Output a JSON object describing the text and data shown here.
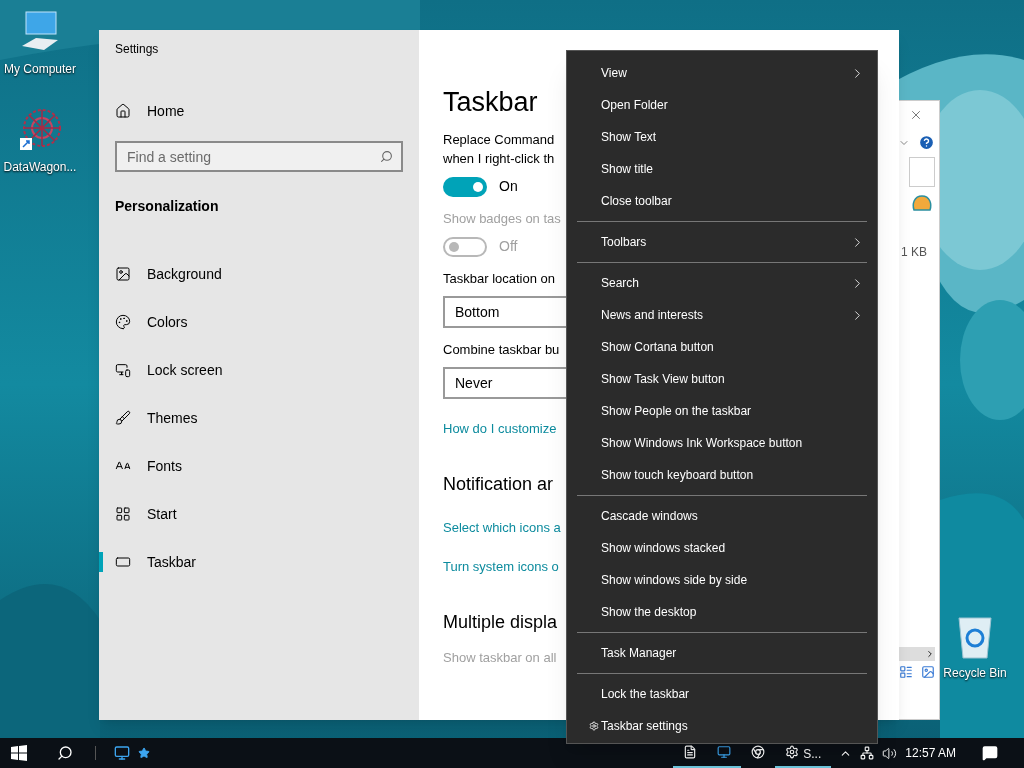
{
  "desktop_icons": [
    {
      "kind": "computer",
      "label": "My Computer"
    },
    {
      "kind": "shortcut",
      "label": "DataWagon..."
    },
    {
      "kind": "recycle",
      "label": "Recycle Bin"
    }
  ],
  "settings": {
    "title": "Settings",
    "sidebar": {
      "home": "Home",
      "search": {
        "placeholder": "Find a setting"
      },
      "section": "Personalization",
      "items": [
        {
          "kind": "background",
          "label": "Background",
          "selected": false
        },
        {
          "kind": "colors",
          "label": "Colors",
          "selected": false
        },
        {
          "kind": "lock",
          "label": "Lock screen",
          "selected": false
        },
        {
          "kind": "themes",
          "label": "Themes",
          "selected": false
        },
        {
          "kind": "fonts",
          "label": "Fonts",
          "selected": false
        },
        {
          "kind": "start",
          "label": "Start",
          "selected": false
        },
        {
          "kind": "taskbar",
          "label": "Taskbar",
          "selected": true
        }
      ]
    },
    "page": {
      "heading": "Taskbar",
      "blocks": [
        {
          "kind": "label",
          "lines": [
            "Replace Command",
            "when I right-click th"
          ],
          "disabled": false
        },
        {
          "kind": "toggle",
          "on": true,
          "disabled": false,
          "text": "On"
        },
        {
          "kind": "label",
          "lines": [
            "Show badges on tas"
          ],
          "disabled": true
        },
        {
          "kind": "toggle",
          "on": false,
          "disabled": true,
          "text": "Off"
        },
        {
          "kind": "label",
          "lines": [
            "Taskbar location on"
          ],
          "disabled": false
        },
        {
          "kind": "select",
          "value": "Bottom"
        },
        {
          "kind": "label",
          "lines": [
            "Combine taskbar bu"
          ],
          "disabled": false
        },
        {
          "kind": "select",
          "value": "Never"
        },
        {
          "kind": "link",
          "text": "How do I customize"
        },
        {
          "kind": "heading",
          "text": "Notification ar"
        },
        {
          "kind": "link",
          "text": "Select which icons a"
        },
        {
          "kind": "link",
          "text": "Turn system icons o"
        },
        {
          "kind": "heading",
          "text": "Multiple displa"
        },
        {
          "kind": "label",
          "lines": [
            "Show taskbar on all"
          ],
          "disabled": true
        }
      ]
    }
  },
  "context_menu": {
    "sections": [
      [
        {
          "label": "View",
          "submenu": true
        },
        {
          "label": "Open Folder",
          "submenu": false
        },
        {
          "label": "Show Text",
          "submenu": false
        },
        {
          "label": "Show title",
          "submenu": false
        },
        {
          "label": "Close toolbar",
          "submenu": false
        }
      ],
      [
        {
          "label": "Toolbars",
          "submenu": true
        }
      ],
      [
        {
          "label": "Search",
          "submenu": true
        },
        {
          "label": "News and interests",
          "submenu": true
        },
        {
          "label": "Show Cortana button",
          "submenu": false
        },
        {
          "label": "Show Task View button",
          "submenu": false
        },
        {
          "label": "Show People on the taskbar",
          "submenu": false
        },
        {
          "label": "Show Windows Ink Workspace button",
          "submenu": false
        },
        {
          "label": "Show touch keyboard button",
          "submenu": false
        }
      ],
      [
        {
          "label": "Cascade windows",
          "submenu": false
        },
        {
          "label": "Show windows stacked",
          "submenu": false
        },
        {
          "label": "Show windows side by side",
          "submenu": false
        },
        {
          "label": "Show the desktop",
          "submenu": false
        }
      ],
      [
        {
          "label": "Task Manager",
          "submenu": false
        }
      ],
      [
        {
          "label": "Lock the taskbar",
          "submenu": false
        },
        {
          "label": "Taskbar settings",
          "submenu": false,
          "kind": "with_icon"
        }
      ]
    ]
  },
  "back_window": {
    "size_text": "1 KB"
  },
  "taskbar": {
    "apps": [
      {
        "kind": "document",
        "open": true
      },
      {
        "kind": "window",
        "open": true
      },
      {
        "kind": "browser",
        "open": false
      },
      {
        "kind": "settings",
        "label": "S...",
        "open": true
      }
    ],
    "clock": "12:57 AM"
  }
}
